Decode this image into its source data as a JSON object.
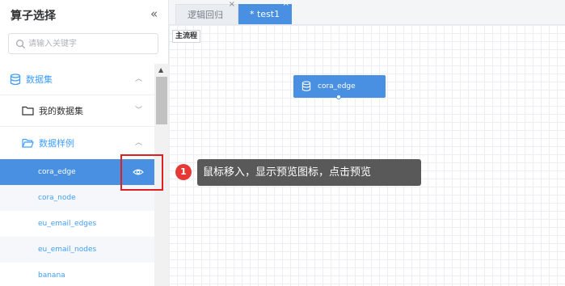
{
  "sidebar": {
    "title": "算子选择",
    "search_placeholder": "请输入关键字",
    "tree": {
      "dataset": {
        "label": "数据集",
        "expanded": true
      },
      "my_datasets": {
        "label": "我的数据集",
        "expanded": false
      },
      "samples": {
        "label": "数据样例",
        "expanded": true,
        "items": [
          {
            "label": "cora_edge",
            "active": true
          },
          {
            "label": "cora_node"
          },
          {
            "label": "eu_email_edges"
          },
          {
            "label": "eu_email_nodes"
          },
          {
            "label": "banana"
          }
        ]
      }
    }
  },
  "tabs": [
    {
      "label": "逻辑回归",
      "active": false
    },
    {
      "label": "* test1",
      "active": true
    }
  ],
  "canvas": {
    "flow_tag": "主流程",
    "node": {
      "label": "cora_edge"
    }
  },
  "annotation": {
    "badge": "1",
    "text": "鼠标移入，显示预览图标，点击预览"
  },
  "colors": {
    "accent": "#4a90e2",
    "link": "#409eff",
    "highlight": "#e02020",
    "tooltip_bg": "#595959"
  }
}
